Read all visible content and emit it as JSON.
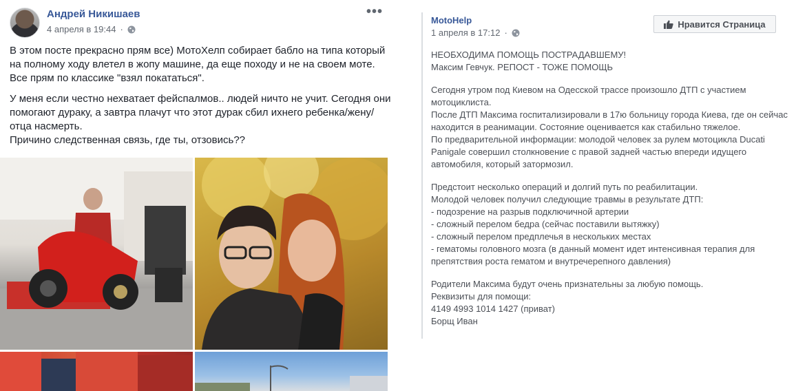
{
  "post": {
    "author": "Андрей Никишаев",
    "timestamp": "4 апреля в 19:44",
    "more_label": "•••",
    "paragraphs": [
      "В этом посте прекрасно прям все) МотоХелп собирает бабло на типа который на полному ходу влетел в жопу машине, да еще походу и не на своем моте. Все прям по классике \"взял покататься\".",
      "У меня если честно нехватает фейспалмов.. людей ничто не учит. Сегодня они помогают дураку, а завтра плачут что этот дурак сбил ихнего ребенка/жену/отца насмерть.\nПричино следственная связь, где ты, отзовись??"
    ]
  },
  "shared": {
    "page_name": "MotoHelp",
    "timestamp": "1 апреля в 17:12",
    "like_button": "Нравится Страница",
    "paragraphs": [
      "НЕОБХОДИМА ПОМОЩЬ ПОСТРАДАВШЕМУ!\nМаксим Гевчук. РЕПОСТ - ТОЖЕ ПОМОЩЬ",
      "Сегодня утром под Киевом на Одесской трассе произошло ДТП с участием мотоциклиста.\nПосле ДТП Максима госпитализировали в 17ю больницу города Киева, где он сейчас находится в реанимации. Состояние оценивается как стабильно тяжелое.\nПо предварительной информации: молодой человек за рулем мотоцикла Ducati Panigale совершил столкновение с правой задней частью впереди идущего автомобиля, который затормозил.",
      "Предстоит несколько операций и долгий путь по реабилитации.\nМолодой человек получил следующие травмы в результате ДТП:\n- подозрение на разрыв подключичной артерии\n- сложный перелом бедра (сейчас поставили вытяжку)\n- сложный перелом предплечья в нескольких местах\n- гематомы головного мозга (в данный момент идет интенсивная терапия для препятствия роста гематом и внутречерепного давления)",
      "Родители Максима будут очень признательны за любую помощь.\nРеквизиты для помощи:\n4149 4993 1014 1427 (приват)\nБорщ Иван"
    ]
  },
  "icons": {
    "globe": "globe-icon",
    "thumb": "thumbs-up-icon"
  },
  "colors": {
    "link": "#385898",
    "meta": "#616770",
    "body_text": "#1d2129",
    "shared_text": "#4b4f56"
  }
}
